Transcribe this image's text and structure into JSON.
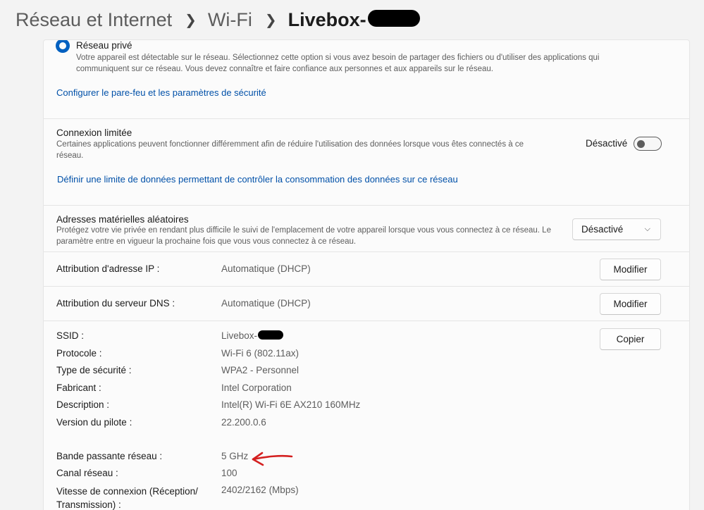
{
  "breadcrumb": {
    "level1": "Réseau et Internet",
    "level2": "Wi-Fi",
    "current": "Livebox-"
  },
  "profile": {
    "private_label": "Réseau privé",
    "private_desc": "Votre appareil est détectable sur le réseau. Sélectionnez cette option si vous avez besoin de partager des fichiers ou d'utiliser des applications qui communiquent sur ce réseau. Vous devez connaître et faire confiance aux personnes et aux appareils sur le réseau.",
    "firewall_link": "Configurer le pare-feu et les paramètres de sécurité"
  },
  "metered": {
    "title": "Connexion limitée",
    "desc": "Certaines applications peuvent fonctionner différemment afin de réduire l'utilisation des données lorsque vous êtes connectés à ce réseau.",
    "state": "Désactivé",
    "is_on": false,
    "data_limit_link": "Définir une limite de données permettant de contrôler la consommation des données sur ce réseau"
  },
  "random_mac": {
    "title": "Adresses matérielles aléatoires",
    "desc": "Protégez votre vie privée en rendant plus difficile le suivi de l'emplacement de votre appareil lorsque vous vous connectez à ce réseau. Le paramètre entre en vigueur la prochaine fois que vous vous connectez à ce réseau.",
    "selected": "Désactivé"
  },
  "ip": {
    "label": "Attribution d'adresse IP :",
    "value": "Automatique (DHCP)",
    "button": "Modifier"
  },
  "dns": {
    "label": "Attribution du serveur DNS :",
    "value": "Automatique (DHCP)",
    "button": "Modifier"
  },
  "props": {
    "copy_button": "Copier",
    "ssid_label": "SSID :",
    "ssid_value": "Livebox-",
    "protocol_label": "Protocole :",
    "protocol_value": "Wi-Fi 6 (802.11ax)",
    "security_label": "Type de sécurité :",
    "security_value": "WPA2 - Personnel",
    "maker_label": "Fabricant :",
    "maker_value": "Intel Corporation",
    "description_label": "Description :",
    "description_value": "Intel(R) Wi-Fi 6E AX210 160MHz",
    "driver_label": "Version du pilote :",
    "driver_value": "22.200.0.6",
    "band_label": "Bande passante réseau :",
    "band_value": "5 GHz",
    "channel_label": "Canal réseau :",
    "channel_value": "100",
    "speed_label_1": "Vitesse de connexion (Réception/",
    "speed_label_2": "Transmission) :",
    "speed_value": "2402/2162 (Mbps)"
  },
  "colors": {
    "accent": "#0060c0",
    "link": "#0050a8",
    "annotation_arrow": "#d42020"
  }
}
